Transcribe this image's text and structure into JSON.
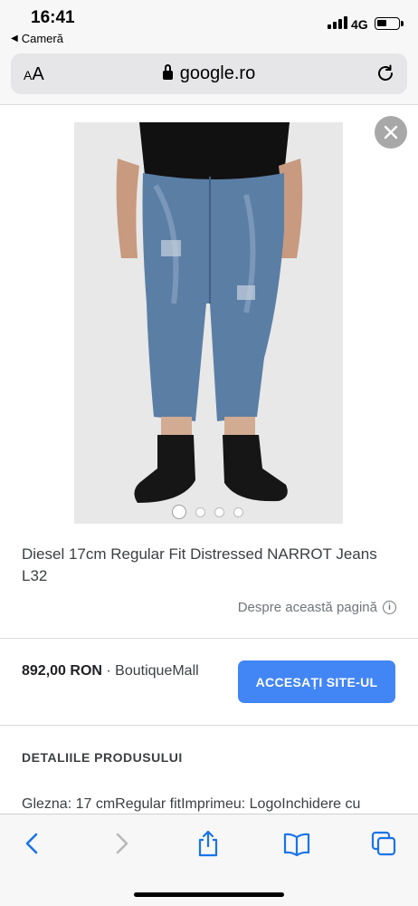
{
  "status_bar": {
    "time": "16:41",
    "back_app": "Cameră",
    "network": "4G",
    "battery_level": 0.45
  },
  "browser": {
    "text_size_label_small": "A",
    "text_size_label_large": "A",
    "domain": "google.ro",
    "icons": [
      "lock-icon",
      "reload-icon"
    ]
  },
  "product": {
    "image_alt": "Diesel NARROT jeans on model",
    "carousel": {
      "count": 4,
      "active_index": 0
    },
    "title": "Diesel 17cm Regular Fit Distressed NARROT Jeans L32",
    "about_link": "Despre această pagină",
    "price": "892,00 RON",
    "separator": "·",
    "seller": "BoutiqueMall",
    "cta_label": "ACCESAȚI SITE-UL",
    "details_heading": "DETALIILE PRODUSULUI",
    "details_text": "Glezna: 17 cmRegular fitImprimeu: LogoInchidere cu"
  },
  "toolbar": {
    "icons": [
      "back-icon",
      "forward-icon",
      "share-icon",
      "bookmarks-icon",
      "tabs-icon"
    ]
  },
  "colors": {
    "accent": "#4285f4",
    "ios_blue": "#1a73e8"
  }
}
